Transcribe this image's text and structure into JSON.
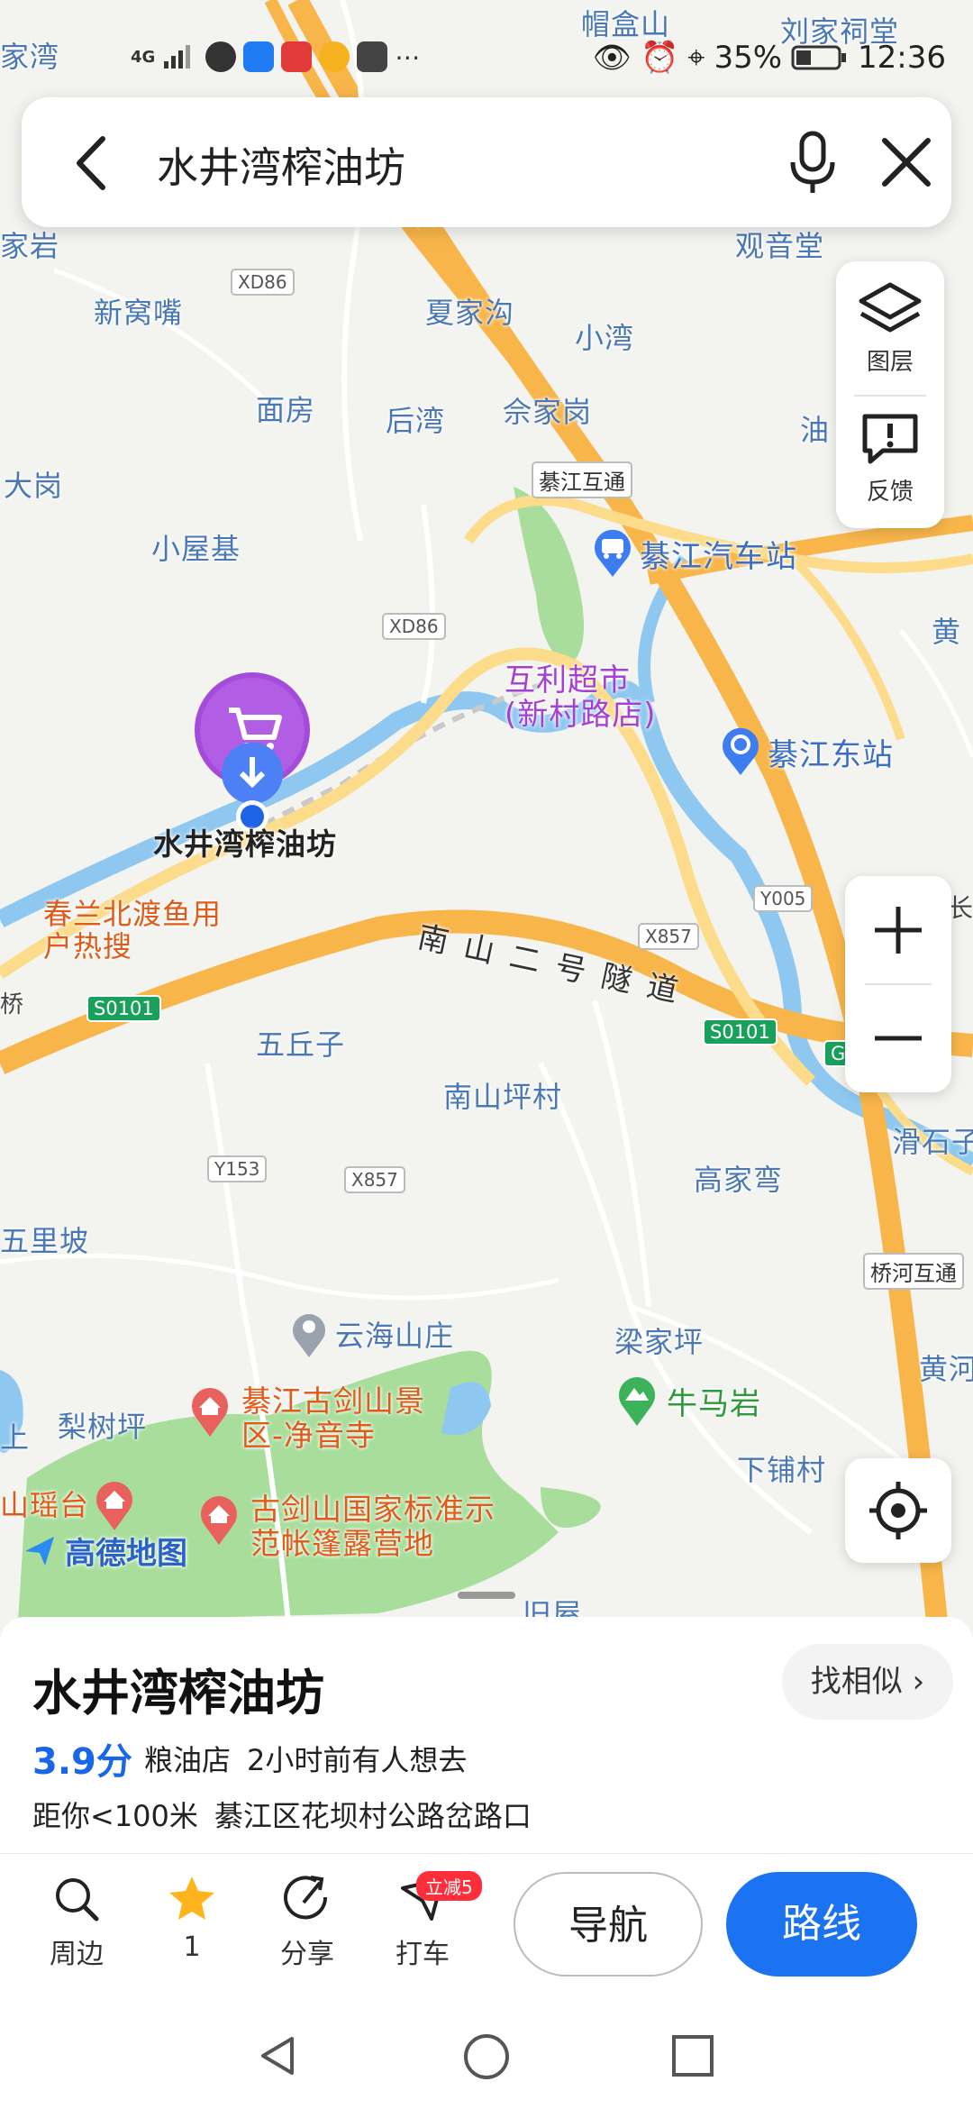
{
  "status_bar": {
    "network": "4G",
    "battery": "35%",
    "time": "12:36"
  },
  "search": {
    "query": "水井湾榨油坊"
  },
  "side_controls": {
    "layers_label": "图层",
    "feedback_label": "反馈"
  },
  "map": {
    "logo_text": "高德地图",
    "selected_label": "水井湾榨油坊",
    "labels": {
      "maoheshan": "帽盒山",
      "liujiacitang": "刘家祠堂",
      "jiawan": "家湾",
      "jiayan": "家岩",
      "guanyintang": "观音堂",
      "xinwozui": "新窝嘴",
      "xiajiagou": "夏家沟",
      "xiaowan": "小湾",
      "mianfang": "面房",
      "houwan": "后湾",
      "shejiagang": "佘家岗",
      "you": "油",
      "dagang": "大岗",
      "xiaowuji": "小屋基",
      "huang1": "黄",
      "wuqiuzi": "五丘子",
      "nanshanpingcun": "南山坪村",
      "gaojiawan": "高家弯",
      "huashizi": "滑石子",
      "wulipo": "五里坡",
      "yunhaishanzhuang": "云海山庄",
      "liangjiaping": "梁家坪",
      "huanghe": "黄河",
      "lishuping": "梨树坪",
      "niumayan": "牛马岩",
      "shang": "上",
      "xiapucun": "下铺村",
      "shanyaotai": "山瑶台",
      "jiuwu": "旧屋",
      "qiao": "桥",
      "chang": "长",
      "nanshan_tunnel": "南山二号隧道"
    },
    "poi": {
      "qijiang_bus_station": "綦江汽车站",
      "huli_supermarket": "互利超市(新村路店)",
      "qijiang_east_station": "綦江东站",
      "chunlan_fish": "春兰北渡鱼用户热搜",
      "gujianshan_temple": "綦江古剑山景区-净音寺",
      "gujianshan_camp": "古剑山国家标准示范帐篷露营地",
      "qijiang_interchange": "綦江互通",
      "qiaohe_interchange": "桥河互通"
    },
    "shields": {
      "xd86_a": "XD86",
      "xd86_b": "XD86",
      "y005": "Y005",
      "x857_a": "X857",
      "x857_b": "X857",
      "y153": "Y153",
      "s0101_a": "S0101",
      "s0101_b": "S0101",
      "g": "G"
    }
  },
  "place": {
    "name": "水井湾榨油坊",
    "similar_button": "找相似",
    "rating": "3.9分",
    "category": "粮油店",
    "recent_interest": "2小时前有人想去",
    "distance": "距你<100米",
    "address": "綦江区花坝村公路岔路口"
  },
  "actions": {
    "nearby": "周边",
    "favorite_count": "1",
    "share": "分享",
    "taxi": "打车",
    "taxi_badge": "立减5",
    "navigate": "导航",
    "route": "路线"
  },
  "colors": {
    "accent": "#1c73f2",
    "highway": "#f7b54a",
    "road": "#fcdc8a",
    "river": "#8ec8f0",
    "park": "#a6dd9a",
    "pin": "#a44bdc"
  }
}
